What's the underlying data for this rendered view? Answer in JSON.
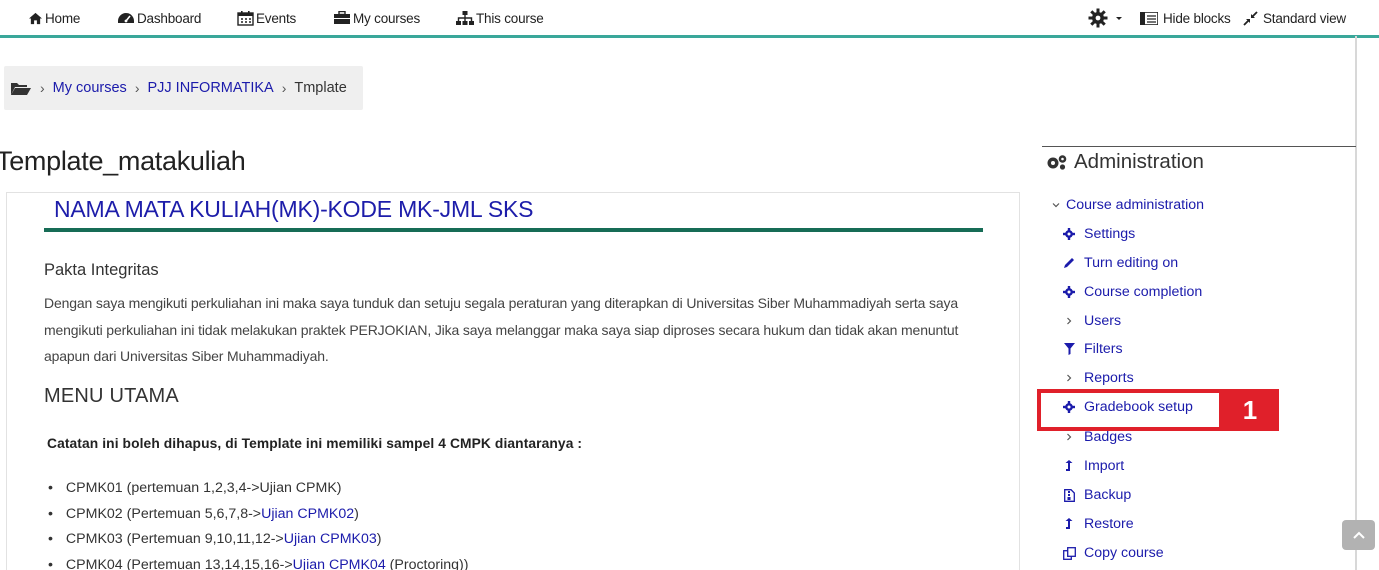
{
  "navbar": {
    "home": "Home",
    "dashboard": "Dashboard",
    "events": "Events",
    "my_courses": "My courses",
    "this_course": "This course",
    "hide_blocks": "Hide blocks",
    "standard_view": "Standard view"
  },
  "breadcrumb": {
    "items": [
      "My courses",
      "PJJ INFORMATIKA",
      "Tmplate"
    ]
  },
  "page": {
    "title": "Template_matakuliah"
  },
  "content": {
    "course_heading": "NAMA MATA KULIAH(MK)-KODE MK-JML SKS",
    "pakta_heading": "Pakta Integritas",
    "pakta_text": "Dengan saya mengikuti perkuliahan ini maka saya tunduk dan setuju segala peraturan yang diterapkan di Universitas Siber Muhammadiyah serta saya mengikuti perkuliahan ini tidak melakukan praktek PERJOKIAN, Jika saya melanggar maka saya siap diproses secara hukum dan tidak akan menuntut apapun dari Universitas Siber Muhammadiyah.",
    "menu_heading": "MENU UTAMA",
    "note": "Catatan ini boleh dihapus, di Template ini memiliki sampel 4 CMPK diantaranya :",
    "cpmk": [
      {
        "prefix": "CPMK01 (pertemuan 1,2,3,4->Ujian CPMK)",
        "link": "",
        "suffix": ""
      },
      {
        "prefix": "CPMK02 (Pertemuan 5,6,7,8->",
        "link": "Ujian CPMK02",
        "suffix": ")"
      },
      {
        "prefix": "CPMK03 (Pertemuan 9,10,11,12->",
        "link": "Ujian CPMK03",
        "suffix": ")"
      },
      {
        "prefix": "CPMK04 (Pertemuan 13,14,15,16->",
        "link": "Ujian CPMK04",
        "suffix": " (Proctoring))"
      }
    ]
  },
  "admin": {
    "title": "Administration",
    "section": "Course administration",
    "items": [
      "Settings",
      "Turn editing on",
      "Course completion",
      "Users",
      "Filters",
      "Reports",
      "Gradebook setup",
      "Badges",
      "Import",
      "Backup",
      "Restore",
      "Copy course"
    ],
    "callout_number": "1"
  },
  "colors": {
    "link": "#1b1bab",
    "accent_line": "#3aa79a",
    "heading_rule": "#176c56",
    "callout": "#e0202a"
  }
}
